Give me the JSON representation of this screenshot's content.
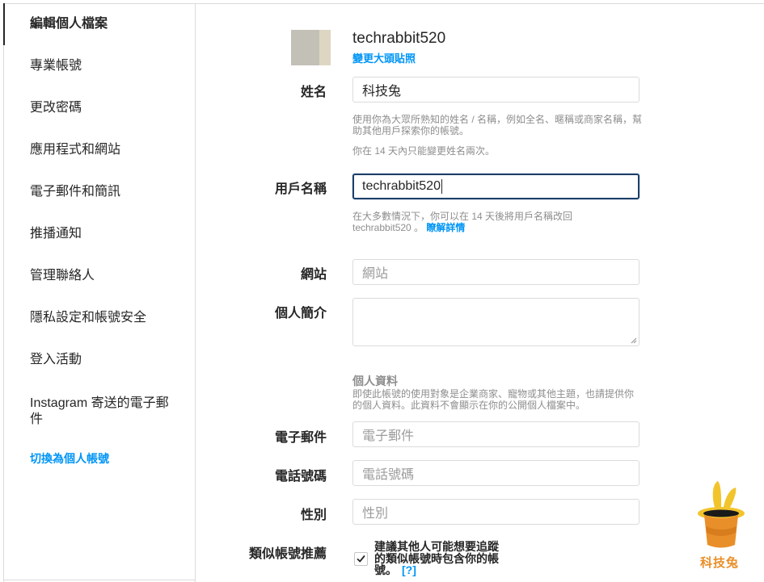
{
  "sidebar": {
    "items": [
      {
        "label": "編輯個人檔案",
        "active": true
      },
      {
        "label": "專業帳號"
      },
      {
        "label": "更改密碼"
      },
      {
        "label": "應用程式和網站"
      },
      {
        "label": "電子郵件和簡訊"
      },
      {
        "label": "推播通知"
      },
      {
        "label": "管理聯絡人"
      },
      {
        "label": "隱私設定和帳號安全"
      },
      {
        "label": "登入活動"
      },
      {
        "label": "Instagram 寄送的電子郵件"
      }
    ],
    "switch_label": "切換為個人帳號"
  },
  "profile": {
    "username": "techrabbit520",
    "change_photo": "變更大頭貼照"
  },
  "form": {
    "name": {
      "label": "姓名",
      "value": "科技兔",
      "help1": "使用你為大眾所熟知的姓名 / 名稱，例如全名、暱稱或商家名稱，幫助其他用戶探索你的帳號。",
      "help2": "你在 14 天內只能變更姓名兩次。"
    },
    "username": {
      "label": "用戶名稱",
      "value": "techrabbit520",
      "help": "在大多數情況下，你可以在 14 天後將用戶名稱改回 techrabbit520 。",
      "help_link": "瞭解詳情"
    },
    "website": {
      "label": "網站",
      "placeholder": "網站"
    },
    "bio": {
      "label": "個人簡介"
    },
    "personal_info": {
      "title": "個人資料",
      "help": "即使此帳號的使用對象是企業商家、寵物或其他主題，也請提供你的個人資料。此資料不會顯示在你的公開個人檔案中。"
    },
    "email": {
      "label": "電子郵件",
      "placeholder": "電子郵件"
    },
    "phone": {
      "label": "電話號碼",
      "placeholder": "電話號碼"
    },
    "gender": {
      "label": "性別",
      "placeholder": "性別"
    },
    "suggestions": {
      "label": "類似帳號推薦",
      "text": "建議其他人可能想要追蹤的類似帳號時包含你的帳號。",
      "help_link": "[?]",
      "checked": true
    }
  },
  "watermark": {
    "text": "科技兔"
  },
  "colors": {
    "accent": "#0095f6",
    "text": "#262626",
    "muted": "#8e8e8e",
    "border": "#dbdbdb",
    "logo": "#e98f2a"
  }
}
